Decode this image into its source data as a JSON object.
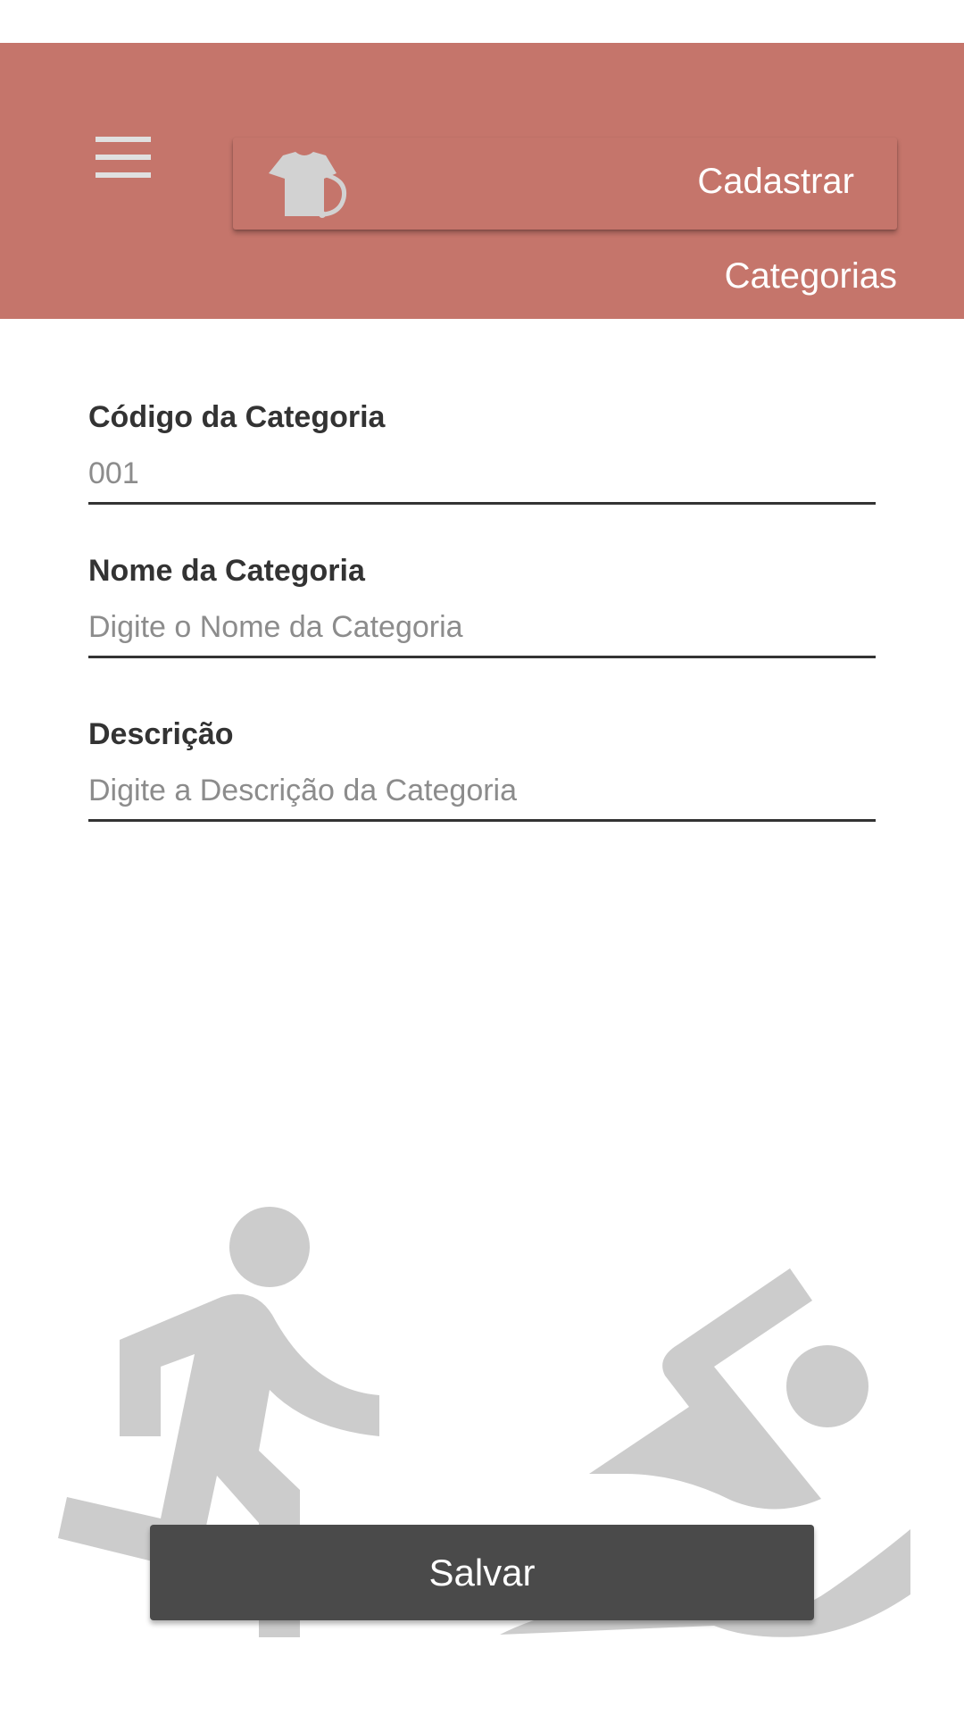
{
  "header": {
    "title_line1": "Cadastrar",
    "title_line2": "Categorias",
    "background_color": "#c5756b",
    "menu_icon": "menu-icon",
    "logo_icon": "shirt-icon"
  },
  "form": {
    "code": {
      "label": "Código da Categoria",
      "placeholder": "001",
      "value": ""
    },
    "name": {
      "label": "Nome da Categoria",
      "placeholder": "Digite o Nome da Categoria",
      "value": ""
    },
    "description": {
      "label": "Descrição",
      "placeholder": "Digite a Descrição da Categoria",
      "value": ""
    }
  },
  "illustration": {
    "icons": [
      "running-person-icon",
      "swimming-person-icon"
    ],
    "color": "#cccccc"
  },
  "actions": {
    "save_label": "Salvar",
    "button_color": "#4a4a4a"
  }
}
